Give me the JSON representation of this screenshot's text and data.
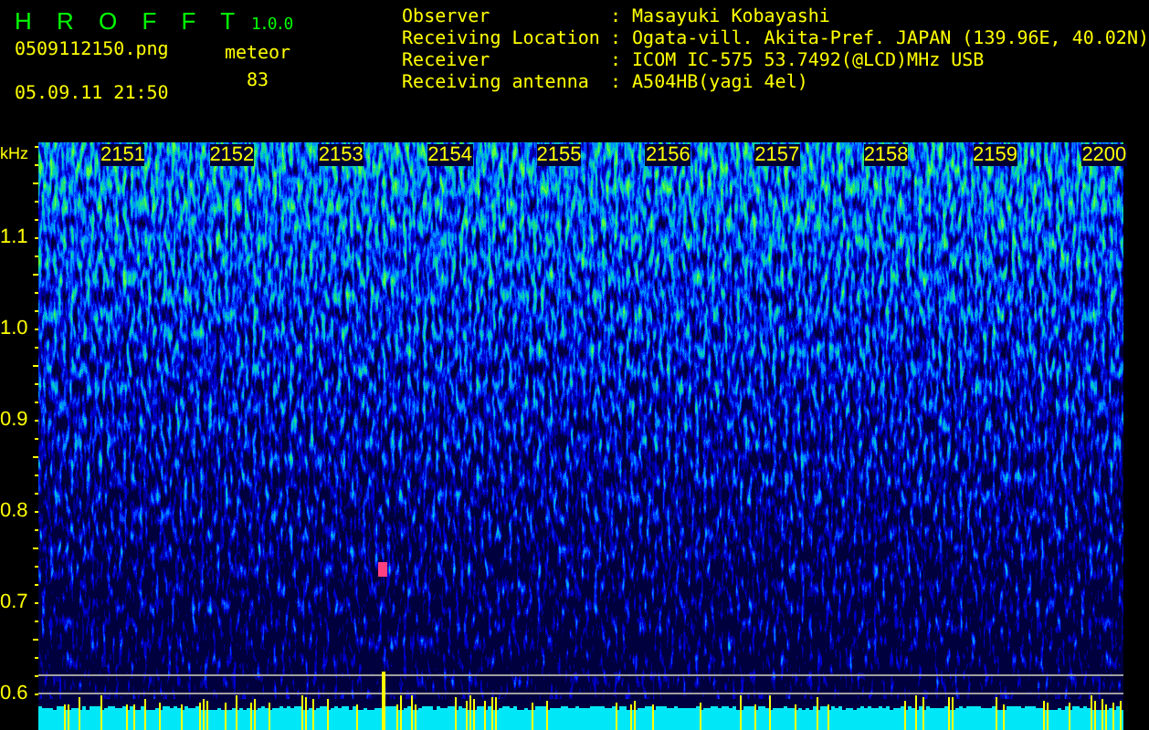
{
  "app": {
    "name": "H R O F F T",
    "version": "1.0.0"
  },
  "file": "0509112150.png",
  "datetime": "05.09.11 21:50",
  "meteor": {
    "label": "meteor",
    "count": "83"
  },
  "info": [
    {
      "label": "Observer",
      "separator": ":",
      "value": "Masayuki Kobayashi"
    },
    {
      "label": "Receiving Location",
      "separator": ":",
      "value": "Ogata-vill. Akita-Pref. JAPAN (139.96E, 40.02N)"
    },
    {
      "label": "Receiver",
      "separator": ":",
      "value": "ICOM IC-575 53.7492(@LCD)MHz USB"
    },
    {
      "label": "Receiving antenna",
      "separator": ":",
      "value": "A504HB(yagi 4el)"
    }
  ],
  "spectrogram": {
    "y_unit": "kHz",
    "y_labels": [
      "1.1",
      "1.0",
      "0.9",
      "0.8",
      "0.7",
      "0.6"
    ],
    "time_labels": [
      "2151",
      "2152",
      "2153",
      "2154",
      "2155",
      "2156",
      "2157",
      "2158",
      "2159",
      "2200"
    ]
  }
}
